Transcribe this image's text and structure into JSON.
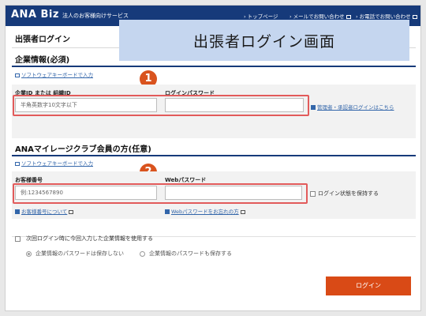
{
  "header": {
    "logo": "ANA Biz",
    "subtitle": "法人のお客様向けサービス",
    "nav": [
      {
        "label": "トップページ"
      },
      {
        "label": "メールでお問い合わせ"
      },
      {
        "label": "お電話でお問い合わせ"
      }
    ]
  },
  "page": {
    "title": "出張者ログイン"
  },
  "overlay": {
    "text": "出張者ログイン画面"
  },
  "corporate": {
    "title": "企業情報(必須)",
    "software_keyboard": "ソフトウェアキーボードで入力",
    "step": "1",
    "id_label": "企業ID または 組織ID",
    "id_placeholder": "半角英数字10文字以下",
    "password_label": "ログインパスワード",
    "password_value": "",
    "admin_link": "管理者・承認者ログインはこちら"
  },
  "mileage": {
    "title": "ANAマイレージクラブ会員の方(任意)",
    "software_keyboard": "ソフトウェアキーボードで入力",
    "step": "2",
    "number_label": "お客様番号",
    "number_placeholder": "例:1234567890",
    "password_label": "Webパスワード",
    "password_value": "",
    "keep_login": "ログイン状態を保持する",
    "number_help": "お客様番号について",
    "password_help": "Webパスワードをお忘れの方"
  },
  "options": {
    "reuse_label": "次回ログイン時に今回入力した企業情報を使用する",
    "radio_no_save": "企業情報のパスワードは保存しない",
    "radio_save": "企業情報のパスワードも保存する"
  },
  "login_button": "ログイン"
}
